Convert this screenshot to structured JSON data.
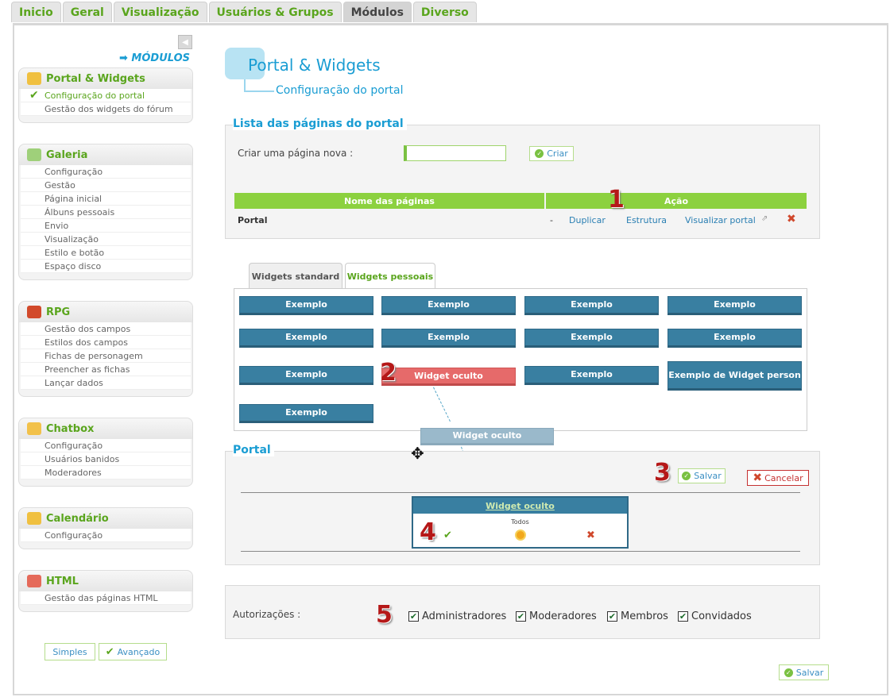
{
  "top_tabs": [
    "Inicio",
    "Geral",
    "Visualização",
    "Usuários & Grupos",
    "Módulos",
    "Diverso"
  ],
  "active_tab": "Módulos",
  "sidebar": {
    "heading": "➡ MÓDULOS",
    "collapse_glyph": "◀",
    "sections": [
      {
        "title": "Portal & Widgets",
        "items": [
          "Configuração do portal",
          "Gestão dos widgets do fórum"
        ]
      },
      {
        "title": "Galeria",
        "items": [
          "Configuração",
          "Gestão",
          "Página inicial",
          "Álbuns pessoais",
          "Envio",
          "Visualização",
          "Estilo e botão",
          "Espaço disco"
        ]
      },
      {
        "title": "RPG",
        "items": [
          "Gestão dos campos",
          "Estilos dos campos",
          "Fichas de personagem",
          "Preencher as fichas",
          "Lançar dados"
        ]
      },
      {
        "title": "Chatbox",
        "items": [
          "Configuração",
          "Usuários banidos",
          "Moderadores"
        ]
      },
      {
        "title": "Calendário",
        "items": [
          "Configuração"
        ]
      },
      {
        "title": "HTML",
        "items": [
          "Gestão das páginas HTML"
        ]
      }
    ],
    "mode_simple": "Simples",
    "mode_advanced": "Avançado"
  },
  "main": {
    "title": "Portal & Widgets",
    "subtitle": "Configuração do portal",
    "pages_section": {
      "title": "Lista das páginas do portal",
      "create_label": "Criar uma página nova :",
      "create_value": "",
      "create_button": "Criar",
      "col_name": "Nome das páginas",
      "col_action": "Ação",
      "row": {
        "name": "Portal",
        "dash": "-",
        "duplicate": "Duplicar",
        "structure": "Estrutura",
        "view": "Visualizar portal"
      }
    },
    "widget_tabs": [
      "Widgets standard",
      "Widgets pessoais"
    ],
    "widgets": [
      "Exemplo",
      "Exemplo",
      "Exemplo",
      "Exemplo",
      "Exemplo",
      "Exemplo",
      "Exemplo",
      "Exemplo",
      "Exemplo",
      "Widget oculto",
      "Exemplo",
      "Exemplo de Widget person",
      "Exemplo"
    ],
    "dragging_widget": "Widget oculto",
    "portal_section": {
      "title": "Portal",
      "save": "Salvar",
      "cancel": "Cancelar",
      "placed_widget_title": "Widget oculto",
      "placed_widget_visibility": "Todos"
    },
    "permissions": {
      "label": "Autorizações :",
      "options": [
        {
          "label": "Administradores",
          "checked": true
        },
        {
          "label": "Moderadores",
          "checked": true
        },
        {
          "label": "Membros",
          "checked": true
        },
        {
          "label": "Convidados",
          "checked": true
        }
      ]
    },
    "save_bottom": "Salvar"
  },
  "annotations": [
    "1",
    "2",
    "3",
    "4",
    "5"
  ],
  "colors": {
    "green": "#8cd13f",
    "blue_title": "#1a9dd3",
    "widget_blue": "#397fa1",
    "widget_hidden": "#e66a6a"
  }
}
